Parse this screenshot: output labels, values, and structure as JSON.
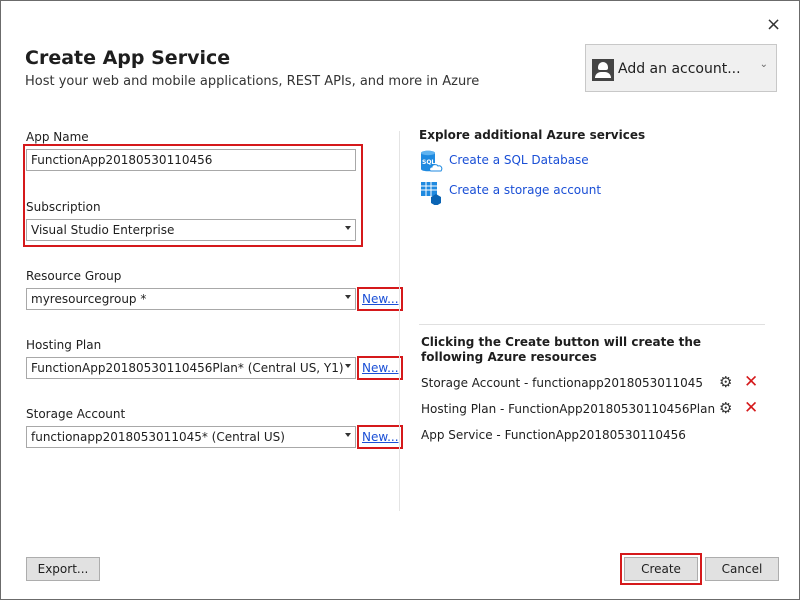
{
  "window": {
    "close_symbol": "×"
  },
  "header": {
    "title": "Create App Service",
    "subtitle": "Host your web and mobile applications, REST APIs, and more in Azure"
  },
  "account": {
    "label": "Add an account..."
  },
  "form": {
    "app_name_label": "App Name",
    "app_name_value": "FunctionApp20180530110456",
    "subscription_label": "Subscription",
    "subscription_value": "Visual Studio Enterprise",
    "resource_group_label": "Resource Group",
    "resource_group_value": "myresourcegroup *",
    "hosting_plan_label": "Hosting Plan",
    "hosting_plan_value": "FunctionApp20180530110456Plan* (Central US, Y1)",
    "storage_account_label": "Storage Account",
    "storage_account_value": "functionapp2018053011045* (Central US)",
    "new_link": "New..."
  },
  "explore": {
    "title": "Explore additional Azure services",
    "links": [
      "Create a SQL Database",
      "Create a storage account"
    ]
  },
  "resources": {
    "heading": "Clicking the Create button will create the following Azure resources",
    "items": [
      "Storage Account - functionapp2018053011045",
      "Hosting Plan - FunctionApp20180530110456Plan",
      "App Service - FunctionApp20180530110456"
    ]
  },
  "footer": {
    "export_label": "Export...",
    "create_label": "Create",
    "cancel_label": "Cancel"
  },
  "colors": {
    "highlight": "#d5191b",
    "link": "#1a4fd6",
    "azure_icon": "#1f8ae0"
  }
}
